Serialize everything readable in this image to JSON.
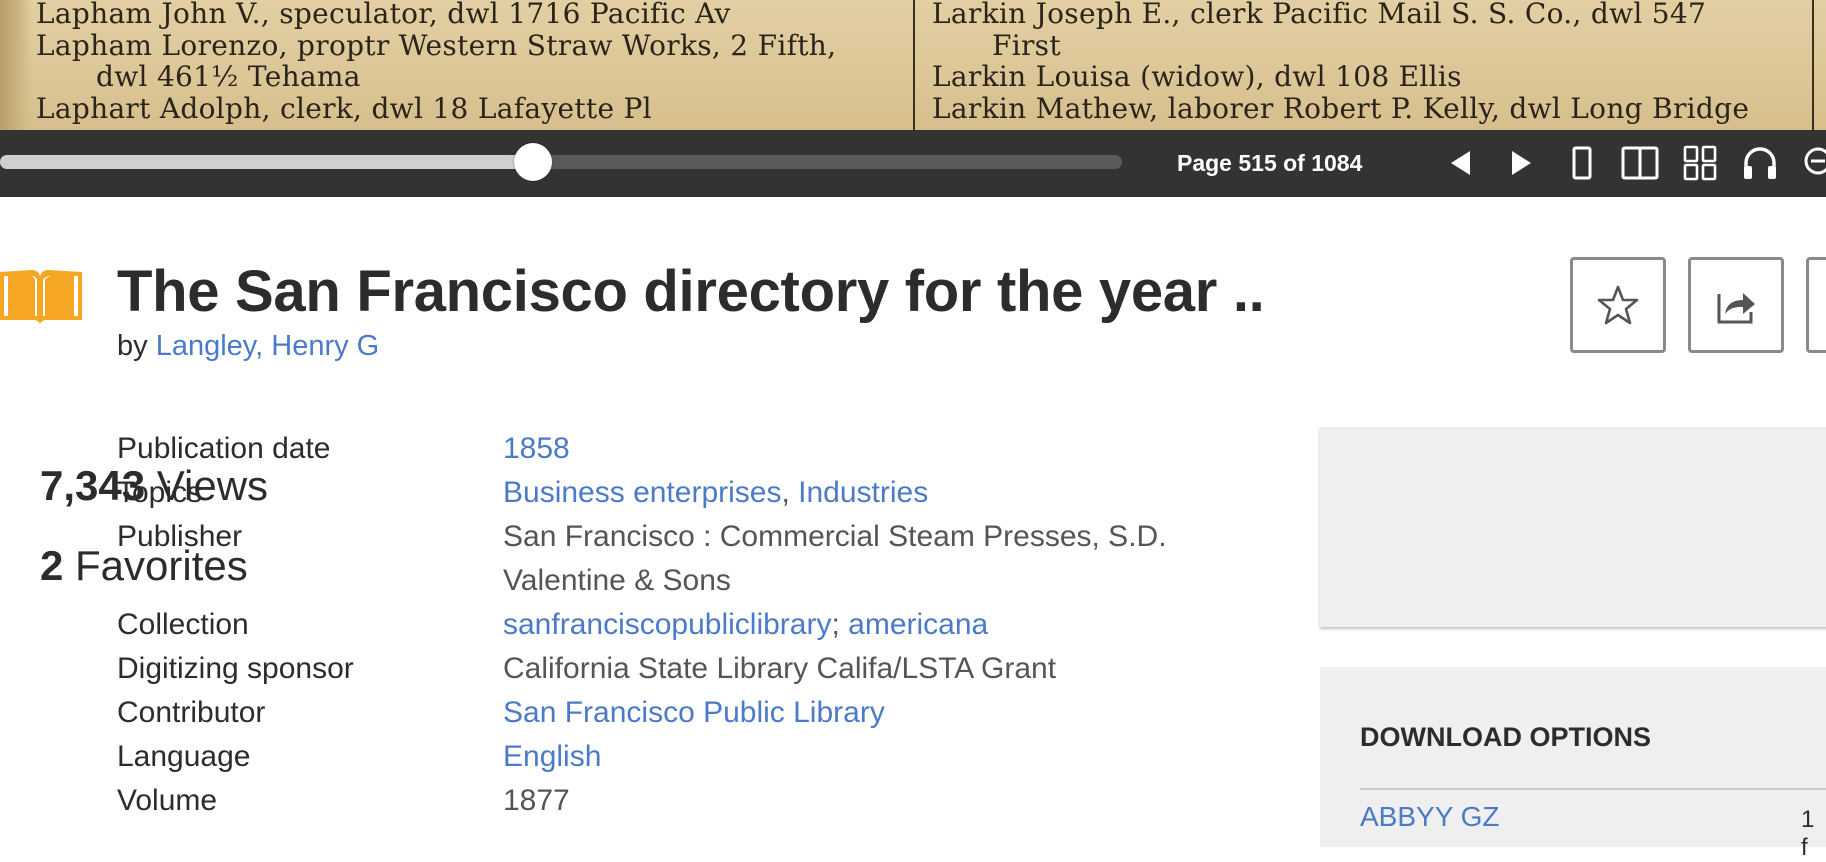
{
  "scan": {
    "left_lines": [
      "Lapham John V., speculator, dwl 1716 Pacific Av",
      "Lapham  Lorenzo, proptr  Western Straw Works, 2 Fifth,",
      "dwl  461½  Tehama",
      "Laphart Adolph, clerk, dwl 18 Lafayette Pl"
    ],
    "right_lines": [
      "Larkin Joseph E.,  clerk  Pacific  Mail  S.  S.  Co., dwl  547",
      "First",
      "Larkin Louisa (widow),  dwl  108 Ellis",
      "Larkin Mathew, laborer Robert P. Kelly, dwl Long Bridge"
    ]
  },
  "viewer": {
    "page_indicator": "Page 515 of 1084",
    "current_page": 515,
    "total_pages": 1084,
    "icons": {
      "prev": "prev-page-icon",
      "next": "next-page-icon",
      "single": "one-page-view-icon",
      "double": "two-page-view-icon",
      "grid": "thumbnail-view-icon",
      "audio": "read-aloud-icon",
      "zoom": "zoom-out-icon"
    }
  },
  "header": {
    "title": "The San Francisco directory for the year ..",
    "by_label": "by",
    "author": "Langley, Henry G",
    "icon": "book-icon",
    "actions": {
      "favorite_icon": "star-icon",
      "share_icon": "share-icon"
    }
  },
  "metadata": {
    "publication_date": {
      "label": "Publication date",
      "value": "1858"
    },
    "topics": {
      "label": "Topics",
      "items": [
        "Business enterprises",
        "Industries"
      ],
      "separator": ", "
    },
    "publisher": {
      "label": "Publisher",
      "line1": "San Francisco : Commercial Steam Presses, S.D.",
      "line2": "Valentine & Sons"
    },
    "collection": {
      "label": "Collection",
      "items": [
        "sanfranciscopubliclibrary",
        "americana"
      ],
      "separator": "; "
    },
    "sponsor": {
      "label": "Digitizing sponsor",
      "value": "California State Library Califa/LSTA Grant"
    },
    "contributor": {
      "label": "Contributor",
      "value": "San Francisco Public Library"
    },
    "language": {
      "label": "Language",
      "value": "English"
    },
    "volume": {
      "label": "Volume",
      "value": "1877"
    }
  },
  "stats": {
    "views_count": "7,343",
    "views_label": "Views",
    "favorites_count": "2",
    "favorites_label": "Favorites"
  },
  "downloads": {
    "title": "DOWNLOAD OPTIONS",
    "first_option": "ABBYY GZ",
    "first_count": "1 f"
  },
  "colors": {
    "toolbar_bg": "#333333",
    "link": "#4b7bc8",
    "book_icon": "#f5a623",
    "panel_bg": "#efefef"
  }
}
